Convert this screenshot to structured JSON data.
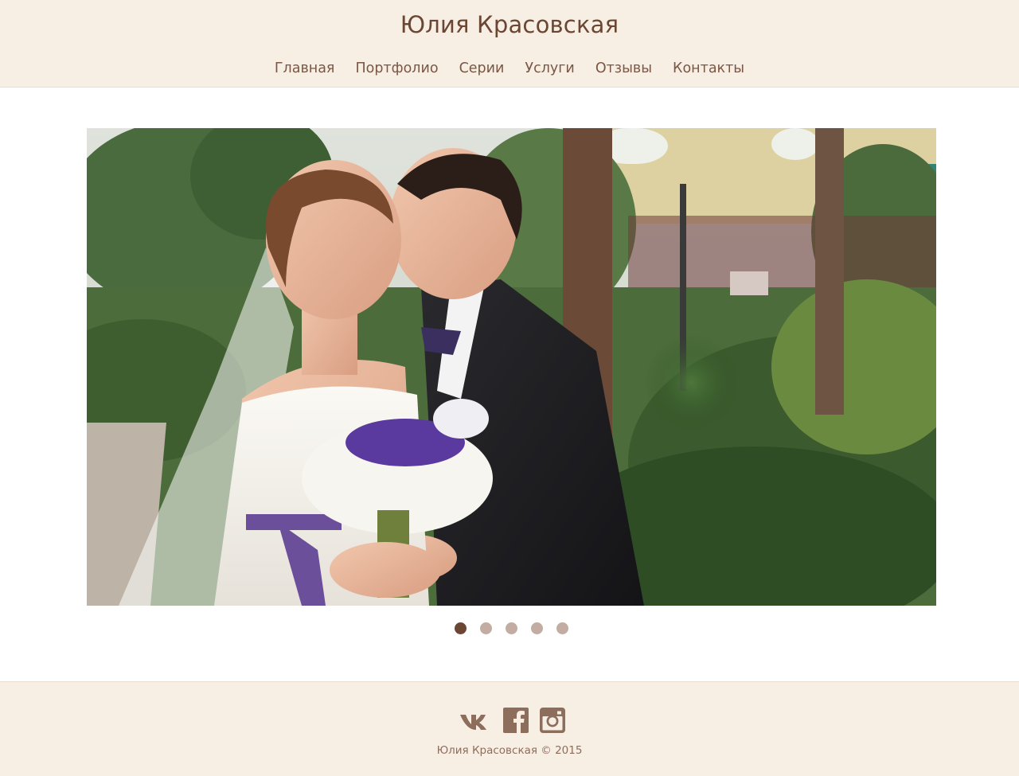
{
  "header": {
    "title": "Юлия Красовская",
    "nav": [
      {
        "label": "Главная"
      },
      {
        "label": "Портфолио"
      },
      {
        "label": "Серии"
      },
      {
        "label": "Услуги"
      },
      {
        "label": "Отзывы"
      },
      {
        "label": "Контакты"
      }
    ]
  },
  "slider": {
    "slide_count": 5,
    "active_index": 0,
    "image": "wedding-couple-photo"
  },
  "footer": {
    "social": [
      {
        "icon": "vk-icon"
      },
      {
        "icon": "facebook-icon"
      },
      {
        "icon": "instagram-icon"
      }
    ],
    "copyright": "Юлия Красовская © 2015"
  },
  "colors": {
    "header_bg": "#f8efe4",
    "text": "#6b4632",
    "dot_active": "#6b4632",
    "dot_inactive": "#c3aca1",
    "icon": "#8d6d5c"
  }
}
